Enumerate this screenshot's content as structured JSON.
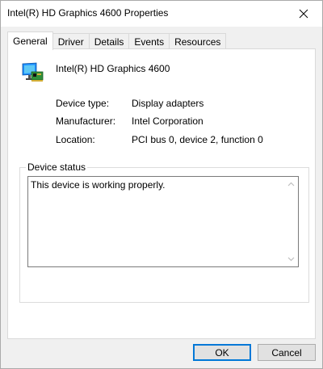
{
  "window": {
    "title": "Intel(R) HD Graphics 4600 Properties",
    "close_glyph": "✕"
  },
  "tabs": [
    {
      "label": "General",
      "active": true
    },
    {
      "label": "Driver",
      "active": false
    },
    {
      "label": "Details",
      "active": false
    },
    {
      "label": "Events",
      "active": false
    },
    {
      "label": "Resources",
      "active": false
    }
  ],
  "general": {
    "device_icon": "display-adapter-icon",
    "device_name": "Intel(R) HD Graphics 4600",
    "properties": [
      {
        "label": "Device type:",
        "value": "Display adapters"
      },
      {
        "label": "Manufacturer:",
        "value": "Intel Corporation"
      },
      {
        "label": "Location:",
        "value": "PCI bus 0, device 2, function 0"
      }
    ],
    "status_group_label": "Device status",
    "status_text": "This device is working properly."
  },
  "buttons": {
    "ok_label": "OK",
    "cancel_label": "Cancel"
  },
  "colors": {
    "accent": "#0078d7"
  }
}
